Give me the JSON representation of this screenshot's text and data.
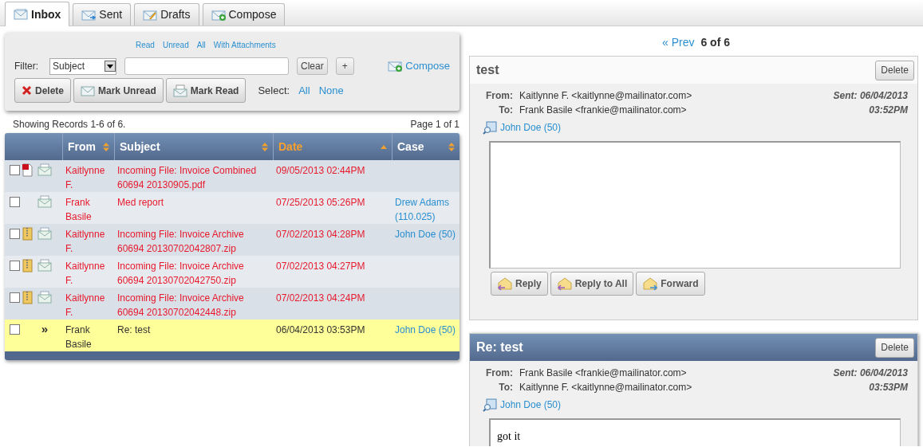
{
  "tabs": [
    {
      "label": "Inbox",
      "kind": "inbox",
      "selected": true
    },
    {
      "label": "Sent",
      "kind": "sent",
      "selected": false
    },
    {
      "label": "Drafts",
      "kind": "drafts",
      "selected": false
    },
    {
      "label": "Compose",
      "kind": "compose",
      "selected": false
    }
  ],
  "filter_panel": {
    "quick_filters": [
      "Read",
      "Unread",
      "All",
      "With Attachments"
    ],
    "filter_label": "Filter:",
    "filter_field": {
      "value": "Subject"
    },
    "clear_button": "Clear",
    "add_button": "+",
    "compose_link": "Compose",
    "actions": [
      {
        "label": "Delete",
        "kind": "delete"
      },
      {
        "label": "Mark Unread",
        "kind": "unread"
      },
      {
        "label": "Mark Read",
        "kind": "read"
      }
    ],
    "select_label": "Select:",
    "select_links": [
      "All",
      "None"
    ]
  },
  "records_info": "Showing Records 1-6 of 6.",
  "page_info": "Page 1 of 1",
  "table": {
    "columns": [
      {
        "label": "From",
        "kind": "sortable",
        "active": false
      },
      {
        "label": "Subject",
        "kind": "sortable",
        "active": false
      },
      {
        "label": "Date",
        "kind": "ascending",
        "active": true
      },
      {
        "label": "Case",
        "kind": "sortable",
        "active": false
      }
    ],
    "rows": [
      {
        "checked": false,
        "kind": "pdf",
        "unread": true,
        "selected": false,
        "from": "Kaitlynne F.",
        "subject": "Incoming File: Invoice Combined 60694 20130905.pdf",
        "date": "09/05/2013 02:44PM"
      },
      {
        "checked": false,
        "kind": "plain",
        "unread": true,
        "selected": false,
        "from": "Frank Basile",
        "subject": "Med report",
        "date": "07/25/2013 05:26PM",
        "case": "Drew Adams (110.025)"
      },
      {
        "checked": false,
        "kind": "zip",
        "unread": true,
        "selected": false,
        "from": "Kaitlynne F.",
        "subject": "Incoming File: Invoice Archive 60694 20130702042807.zip",
        "date": "07/02/2013 04:28PM",
        "case": "John Doe (50)"
      },
      {
        "checked": false,
        "kind": "zip",
        "unread": true,
        "selected": false,
        "from": "Kaitlynne F.",
        "subject": "Incoming File: Invoice Archive 60694 20130702042750.zip",
        "date": "07/02/2013 04:27PM"
      },
      {
        "checked": false,
        "kind": "zip",
        "unread": true,
        "selected": false,
        "from": "Kaitlynne F.",
        "subject": "Incoming File: Invoice Archive 60694 20130702042448.zip",
        "date": "07/02/2013 04:24PM"
      },
      {
        "checked": false,
        "kind": "plain",
        "marker": "»",
        "unread": false,
        "selected": true,
        "from": "Frank Basile",
        "subject": "Re: test",
        "date": "06/04/2013 03:53PM",
        "case": "John Doe (50)"
      }
    ]
  },
  "pager": {
    "prev": "« Prev",
    "position": "6 of 6"
  },
  "messages": [
    {
      "subject": "test",
      "highlighted": false,
      "delete_button": "Delete",
      "from_label": "From:",
      "from": "Kaitlynne F. <kaitlynne@mailinator.com>",
      "to_label": "To:",
      "to": "Frank Basile <frankie@mailinator.com>",
      "sent": "Sent: 06/04/2013 03:52PM",
      "case_link": "John Doe (50)",
      "actions": [
        {
          "label": "Reply",
          "kind": "reply"
        },
        {
          "label": "Reply to All",
          "kind": "reply-all"
        },
        {
          "label": "Forward",
          "kind": "forward"
        }
      ]
    },
    {
      "subject": "Re: test",
      "highlighted": true,
      "delete_button": "Delete",
      "from_label": "From:",
      "from": "Frank Basile <frankie@mailinator.com>",
      "to_label": "To:",
      "to": "Kaitlynne F. <kaitlynne@mailinator.com>",
      "sent": "Sent: 06/04/2013 03:53PM",
      "case_link": "John Doe (50)",
      "body": "got it"
    }
  ]
}
